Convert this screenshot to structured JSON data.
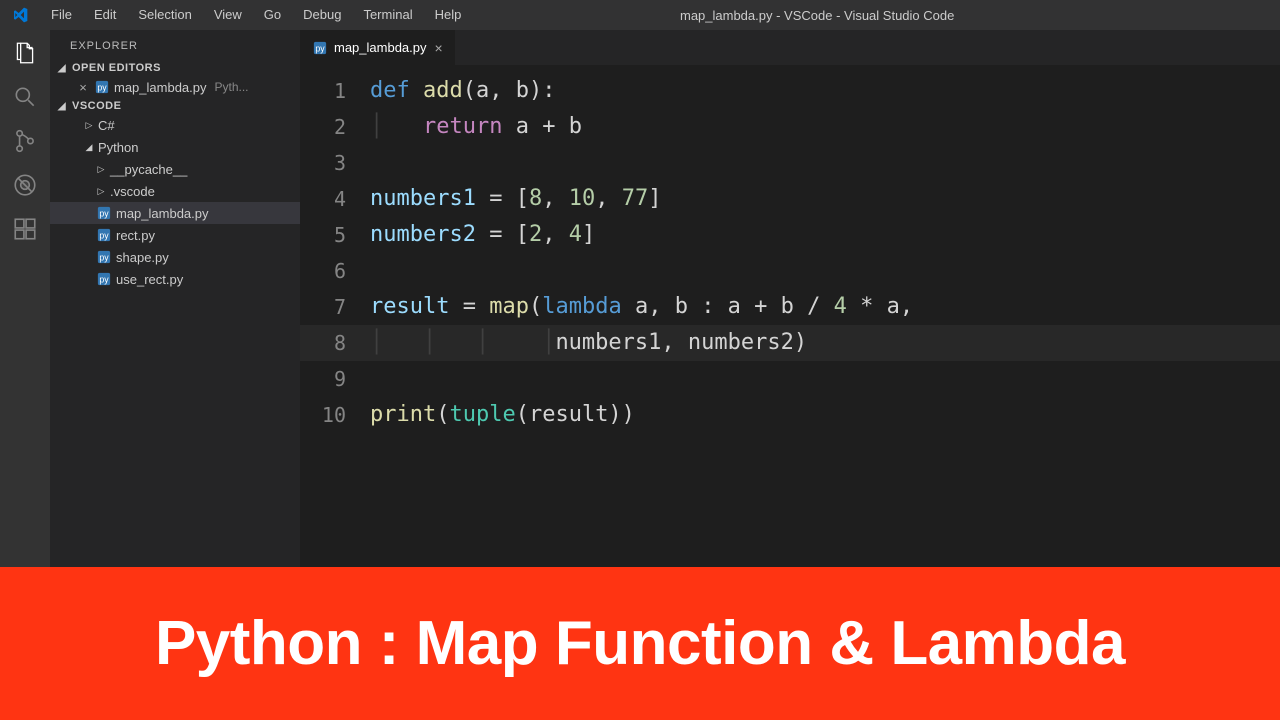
{
  "window": {
    "title": "map_lambda.py - VSCode - Visual Studio Code"
  },
  "menu": [
    "File",
    "Edit",
    "Selection",
    "View",
    "Go",
    "Debug",
    "Terminal",
    "Help"
  ],
  "sidebar": {
    "title": "Explorer",
    "open_editors_label": "Open Editors",
    "open_editor_file": "map_lambda.py",
    "open_editor_meta": "Pyth...",
    "workspace_label": "VSCode",
    "tree": {
      "csharp": "C#",
      "python": "Python",
      "pycache": "__pycache__",
      "vscode": ".vscode",
      "map_lambda": "map_lambda.py",
      "rect": "rect.py",
      "shape": "shape.py",
      "use_rect": "use_rect.py"
    }
  },
  "tab": {
    "label": "map_lambda.py"
  },
  "code": {
    "l1": {
      "num": "1"
    },
    "l2": {
      "num": "2"
    },
    "l3": {
      "num": "3"
    },
    "l4": {
      "num": "4"
    },
    "l5": {
      "num": "5"
    },
    "l6": {
      "num": "6"
    },
    "l7": {
      "num": "7"
    },
    "l8": {
      "num": "8"
    },
    "l9": {
      "num": "9"
    },
    "l10": {
      "num": "10"
    }
  },
  "source": {
    "line1_def": "def",
    "line1_fn": " add",
    "line1_rest": "(a, b):",
    "line2_ret": "return",
    "line2_rest": " a + b",
    "line4_var": "numbers1",
    "line4_rest": " = [",
    "line4_n1": "8",
    "line4_c1": ", ",
    "line4_n2": "10",
    "line4_c2": ", ",
    "line4_n3": "77",
    "line4_end": "]",
    "line5_var": "numbers2",
    "line5_rest": " = [",
    "line5_n1": "2",
    "line5_c1": ", ",
    "line5_n2": "4",
    "line5_end": "]",
    "line7_var": "result",
    "line7_eq": " = ",
    "line7_map": "map",
    "line7_open": "(",
    "line7_lambda": "lambda",
    "line7_rest": " a, b : a + b / ",
    "line7_n": "4",
    "line7_rest2": " * a,",
    "line8_rest": "numbers1, numbers2)",
    "line10_print": "print",
    "line10_open": "(",
    "line10_tuple": "tuple",
    "line10_rest": "(result))"
  },
  "banner": {
    "text": "Python : Map Function & Lambda"
  }
}
